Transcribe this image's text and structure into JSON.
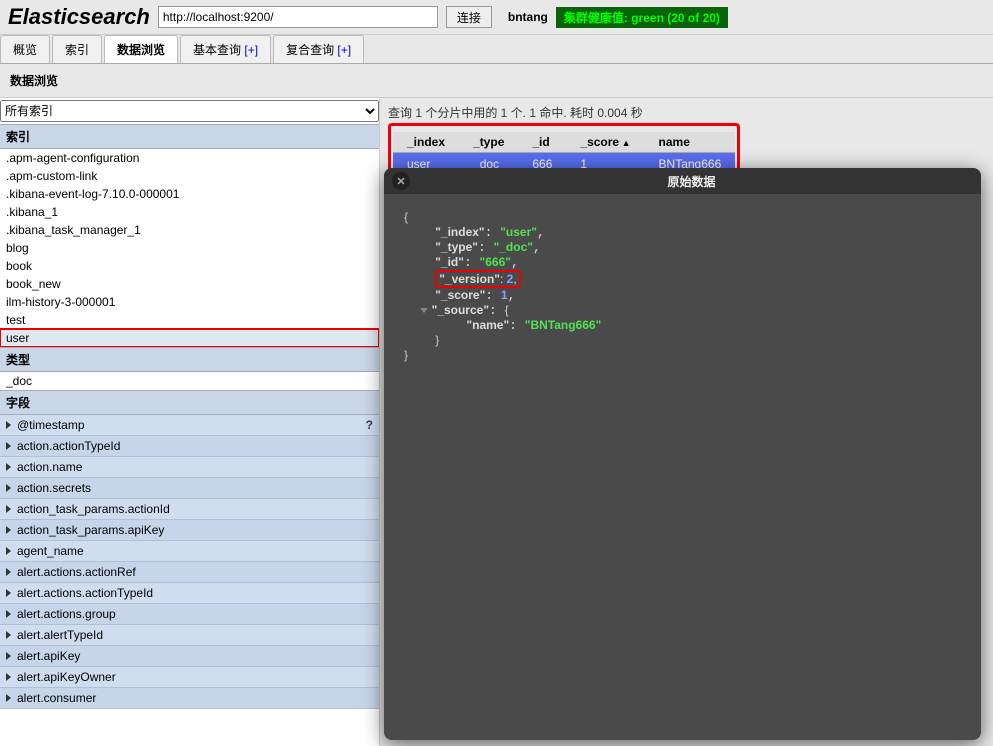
{
  "header": {
    "logo": "Elasticsearch",
    "url": "http://localhost:9200/",
    "connect": "连接",
    "user": "bntang",
    "health": "集群健康值: green (20 of 20)"
  },
  "tabs": [
    "概览",
    "索引",
    "数据浏览",
    "基本查询 [+]",
    "复合查询 [+]"
  ],
  "active_tab": 2,
  "subheader": "数据浏览",
  "select_all": "所有索引",
  "sec_index": "索引",
  "sec_type": "类型",
  "sec_fields": "字段",
  "indices": [
    ".apm-agent-configuration",
    ".apm-custom-link",
    ".kibana-event-log-7.10.0-000001",
    ".kibana_1",
    ".kibana_task_manager_1",
    "blog",
    "book",
    "book_new",
    "ilm-history-3-000001",
    "test",
    "user"
  ],
  "selected_index": "user",
  "types": [
    "_doc"
  ],
  "fields": [
    "@timestamp",
    "action.actionTypeId",
    "action.name",
    "action.secrets",
    "action_task_params.actionId",
    "action_task_params.apiKey",
    "agent_name",
    "alert.actions.actionRef",
    "alert.actions.actionTypeId",
    "alert.actions.group",
    "alert.alertTypeId",
    "alert.apiKey",
    "alert.apiKeyOwner",
    "alert.consumer"
  ],
  "query_info": "查询 1 个分片中用的 1 个. 1 命中. 耗时 0.004 秒",
  "columns": [
    "_index",
    "_type",
    "_id",
    "_score",
    "name"
  ],
  "sort_col": "_score",
  "row": {
    "_index": "user",
    "_type": "_doc",
    "_id": "666",
    "_score": "1",
    "name": "BNTang666"
  },
  "popup": {
    "title": "原始数据",
    "doc": {
      "_index": "user",
      "_type": "_doc",
      "_id": "666",
      "_version": 2,
      "_score": 1,
      "_source": {
        "name": "BNTang666"
      }
    }
  }
}
